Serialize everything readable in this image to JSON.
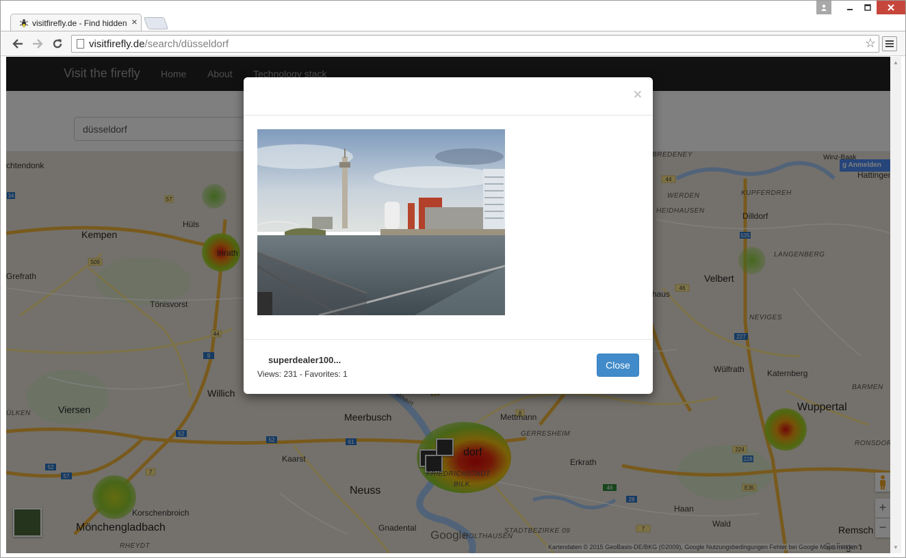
{
  "browser": {
    "tab_title": "visitfirefly.de - Find hidden",
    "tab_close": "×",
    "url_host": "visitfirefly.de",
    "url_path": "/search/düsseldorf",
    "star": "☆"
  },
  "navbar": {
    "brand": "Visit the firefly",
    "links": [
      "Home",
      "About",
      "Technology stack"
    ]
  },
  "search": {
    "value": "düsseldorf"
  },
  "map": {
    "anmelden": "Anmelden",
    "attribution": "Kartendaten © 2015 GeoBasis-DE/BKG (©2009), Google    Nutzungsbedingungen     Fehler bei Google Maps melden",
    "google": "Google",
    "zoom_in": "+",
    "zoom_out": "−",
    "labels": {
      "kempen": "Kempen",
      "huls": "Hüls",
      "inrath": "Inrath",
      "grefrath": "Grefrath",
      "tonisvorst": "Tönisvorst",
      "willich": "Willich",
      "viersen": "Viersen",
      "meerbusch": "Meerbusch",
      "kaarst": "Kaarst",
      "neuss": "Neuss",
      "korschenbroich": "Korschenbroich",
      "monchengladbach": "Mönchengladbach",
      "rheydt": "RHEYDT",
      "gnadental": "Gnadental",
      "mettmann": "Mettmann",
      "erkrath": "Erkrath",
      "gerresheim": "GERRESHEIM",
      "haan": "Haan",
      "wald": "Wald",
      "solingen": "Solingen",
      "stadtbezirke": "STADTBEZIRKE 09",
      "wuppertal": "Wuppertal",
      "velbert": "Velbert",
      "wulfrath": "Wülfrath",
      "katernberg": "Katernberg",
      "barmen": "BARMEN",
      "ronsdorf": "RONSDORF",
      "remsch": "Remsch",
      "hattingen": "Hattingen",
      "langenberg": "LANGENBERG",
      "neviges": "NEVIGES",
      "dilldorf": "Dilldorf",
      "kupferdreh": "KUPFERDREH",
      "heidhausen": "HEIDHAUSEN",
      "werden": "WERDEN",
      "bredeney": "BREDENEY",
      "winz": "Winz-Baak",
      "chtendonk": "chtendonk",
      "ulken": "ÜLKEN",
      "bilk": "BILK",
      "friedrichstadt": "FRIEDRICHSTADT",
      "dorf": "dorf",
      "rhein": "Rhein",
      "haus": "haus",
      "holthausen": "HOLTHAUSEN"
    },
    "shields": [
      "34",
      "509",
      "57",
      "44",
      "9",
      "52",
      "52",
      "61",
      "52",
      "57",
      "7",
      "8",
      "224",
      "44",
      "535",
      "227",
      "46",
      "228",
      "224",
      "E35",
      "46",
      "28",
      "7"
    ]
  },
  "modal": {
    "close_x": "×",
    "username": "superdealer100...",
    "stats": "Views: 231 - Favorites: 1",
    "close_button": "Close"
  }
}
